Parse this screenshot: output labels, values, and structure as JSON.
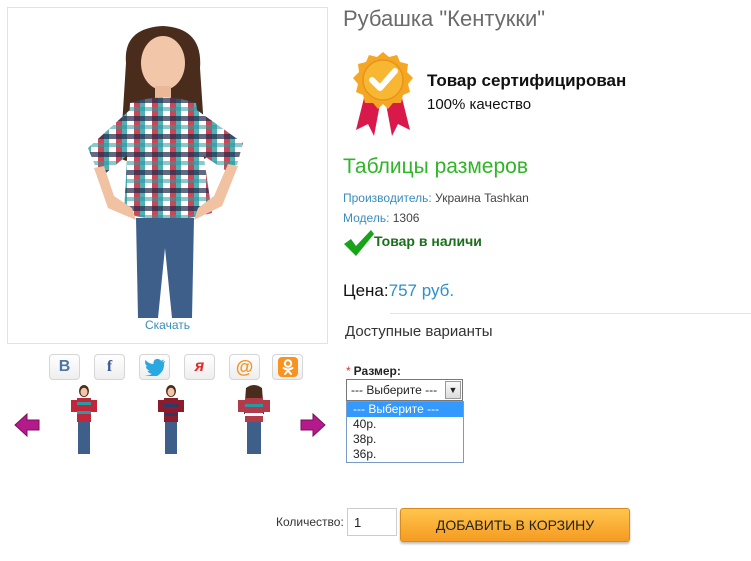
{
  "product": {
    "title": "Рубашка \"Кентукки\"",
    "download_label": "Скачать",
    "certified_title": "Товар сертифицирован",
    "certified_subtitle": "100% качество",
    "size_tables_link": "Таблицы размеров",
    "manufacturer_label": "Производитель:",
    "manufacturer_value": "Украина Tashkan",
    "model_label": "Модель:",
    "model_value": "1306",
    "stock_status": "Товар в наличи",
    "price_label": "Цена:",
    "price_value": "757 руб."
  },
  "social": {
    "buttons": [
      {
        "icon": "vkontakte-icon",
        "glyph": "В",
        "color": "#4d76a1"
      },
      {
        "icon": "facebook-icon",
        "glyph": "f",
        "color": "#3b5998"
      },
      {
        "icon": "twitter-icon",
        "glyph": "",
        "color": "#2aa9e0"
      },
      {
        "icon": "moi-krug-icon",
        "glyph": "я",
        "color": "#e02b2b"
      },
      {
        "icon": "mail-ru-icon",
        "glyph": "@",
        "color": "#f7931e"
      },
      {
        "icon": "odnoklassniki-icon",
        "glyph": "ок",
        "color": "#f7931e"
      }
    ]
  },
  "variants": {
    "heading": "Доступные варианты",
    "size_label": "Размер:",
    "required_mark": "*",
    "selected": "--- Выберите ---",
    "options": [
      "--- Выберите ---",
      "40р.",
      "38р.",
      "36р."
    ]
  },
  "cart": {
    "quantity_label": "Количество:",
    "quantity_value": "1",
    "add_button": "ДОБАВИТЬ В КОРЗИНУ"
  },
  "colors": {
    "accent_green": "#2fb527",
    "link_blue": "#3a8cc0",
    "price_blue": "#2b8fd0",
    "button_orange": "#f59b21",
    "stock_green": "#1b6e1b"
  }
}
